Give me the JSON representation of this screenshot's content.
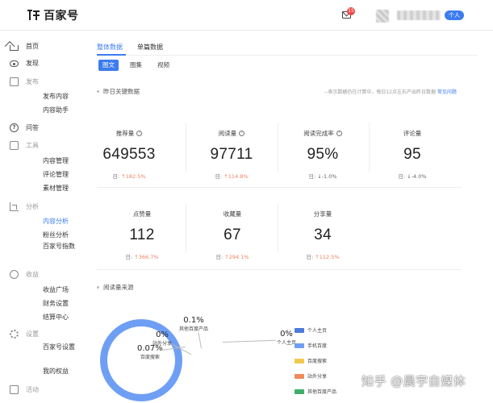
{
  "app": {
    "name": "百家号"
  },
  "header": {
    "notification_count": "15",
    "user_tag": "个人"
  },
  "sidebar": {
    "home": "首页",
    "discover": "发现",
    "publish": {
      "label": "发布",
      "items": [
        "发布内容",
        "内容助手"
      ]
    },
    "qa": "问答",
    "tools": {
      "label": "工具",
      "items": [
        "内容管理",
        "评论管理",
        "素材管理"
      ]
    },
    "analysis": {
      "label": "分析",
      "items": [
        "内容分析",
        "粉丝分析",
        "百家号指数"
      ]
    },
    "income": {
      "label": "收益",
      "items": [
        "收益广场",
        "财务设置",
        "结算中心"
      ]
    },
    "settings": {
      "label": "设置",
      "items": [
        "百家号设置",
        "我的权益"
      ]
    },
    "activity": {
      "label": "活动"
    }
  },
  "main": {
    "tabs": [
      "整体数据",
      "单篇数据"
    ],
    "content_types": [
      "图文",
      "图集",
      "视频"
    ],
    "section_yesterday": "昨日关键数据",
    "notice": "--表示数据仍在计算中，每日12点左右产出昨日数据",
    "notice_link": "常见问题",
    "change_prefix": "日:",
    "stats": [
      {
        "label": "推荐量",
        "value": "649553",
        "arrow": "↑",
        "change": "182.5%",
        "dir": "up"
      },
      {
        "label": "阅读量",
        "value": "97711",
        "arrow": "↑",
        "change": "114.8%",
        "dir": "up"
      },
      {
        "label": "阅读完成率",
        "value": "95%",
        "arrow": "↓",
        "change": "-1.0%",
        "dir": "down"
      },
      {
        "label": "评论量",
        "value": "95",
        "arrow": "↓",
        "change": "-4.0%",
        "dir": "down"
      },
      {
        "label": "点赞量",
        "value": "112",
        "arrow": "↑",
        "change": "366.7%",
        "dir": "up"
      },
      {
        "label": "收藏量",
        "value": "67",
        "arrow": "↑",
        "change": "294.1%",
        "dir": "up"
      },
      {
        "label": "分享量",
        "value": "34",
        "arrow": "↑",
        "change": "112.5%",
        "dir": "up"
      }
    ],
    "section_source": "阅读量来源"
  },
  "chart_data": {
    "type": "pie",
    "title": "阅读量来源",
    "slices": [
      {
        "name": "个人主页",
        "value": "0%",
        "color": "#4a7bd8"
      },
      {
        "name": "手机百度",
        "value": "",
        "color": "#6e9ff4"
      },
      {
        "name": "百度搜索",
        "value": "0.07%",
        "color": "#f2c94c"
      },
      {
        "name": "站外分享",
        "value": "0%",
        "color": "#f08a5d"
      },
      {
        "name": "其他百度产品",
        "value": "0.1%",
        "color": "#3fae6a"
      }
    ],
    "legend_position": "right"
  },
  "watermark": "知乎 @晨宇自媒体"
}
